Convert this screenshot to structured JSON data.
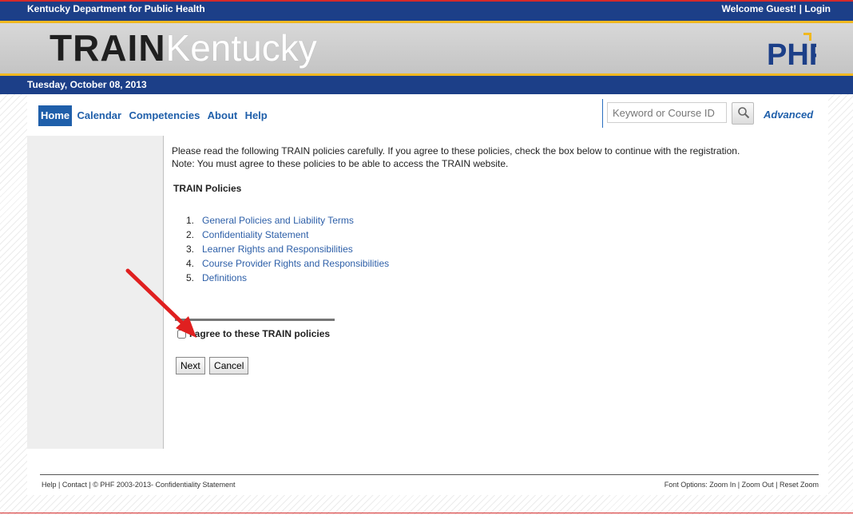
{
  "header": {
    "org": "Kentucky Department for Public Health",
    "welcome": "Welcome Guest!",
    "separator": "|",
    "login": "Login"
  },
  "banner": {
    "logo_train": "TRAIN",
    "logo_state": "Kentucky",
    "partner_logo": "PHF"
  },
  "date": "Tuesday, October 08, 2013",
  "nav": {
    "items": [
      "Home",
      "Calendar",
      "Competencies",
      "About",
      "Help"
    ],
    "active": "Home"
  },
  "search": {
    "placeholder": "Keyword or Course ID",
    "icon": "search-icon",
    "advanced_label": "Advanced"
  },
  "main": {
    "intro_line1": "Please read the following TRAIN policies carefully. If you agree to these policies, check the box below to continue with the registration.",
    "intro_line2": "Note: You must agree to these policies to be able to access the TRAIN website.",
    "heading": "TRAIN Policies",
    "policies": [
      {
        "num": "1.",
        "label": "General Policies and Liability Terms"
      },
      {
        "num": "2.",
        "label": "Confidentiality Statement"
      },
      {
        "num": "3.",
        "label": "Learner Rights and Responsibilities"
      },
      {
        "num": "4.",
        "label": "Course Provider Rights and Responsibilities"
      },
      {
        "num": "5.",
        "label": "Definitions"
      }
    ],
    "agree_label": "I agree to these TRAIN policies",
    "agree_checked": false,
    "next_label": "Next",
    "cancel_label": "Cancel"
  },
  "footer": {
    "help": "Help",
    "sep": "|",
    "contact": "Contact",
    "copyright": "| © PHF 2003-2013-",
    "confidentiality": "Confidentiality Statement",
    "font_options": "Font Options:",
    "zoom_in": "Zoom In",
    "zoom_out": "Zoom Out",
    "reset_zoom": "Reset Zoom"
  },
  "colors": {
    "header_blue": "#1c3f88",
    "accent_gold": "#f0b820",
    "link_blue": "#2d5fa8",
    "annotation_red": "#e02020"
  }
}
